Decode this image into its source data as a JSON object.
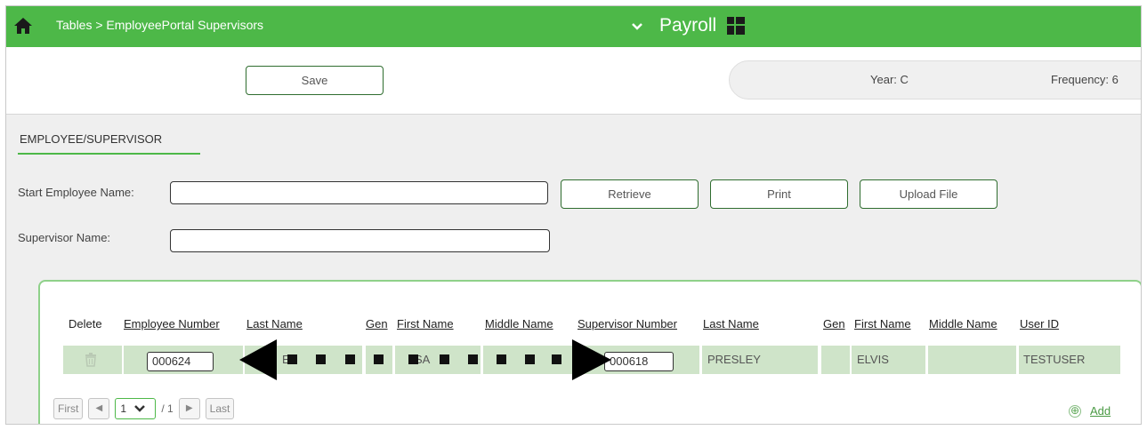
{
  "topbar": {
    "breadcrumb": "Tables > EmployeePortal Supervisors",
    "app_name": "Payroll",
    "app_chevron": "⌄",
    "icons": [
      "home-icon",
      "chevron-down-icon",
      "app-grid-icon"
    ]
  },
  "toolbar": {
    "save_label": "Save",
    "year": "Year: C",
    "frequency": "Frequency: 6"
  },
  "section": {
    "tab_label": "EMPLOYEE/SUPERVISOR"
  },
  "filters": {
    "start_employee_label": "Start Employee Name:",
    "start_employee_value": "",
    "supervisor_label": "Supervisor Name:",
    "supervisor_value": "",
    "retrieve_label": "Retrieve",
    "print_label": "Print",
    "upload_label": "Upload File"
  },
  "grid": {
    "headers": {
      "delete": "Delete",
      "employee_number": "Employee Number",
      "emp_last_name": "Last Name",
      "emp_gen": "Gen",
      "emp_first_name": "First Name",
      "emp_middle_name": "Middle Name",
      "supervisor_number": "Supervisor Number",
      "sup_last_name": "Last Name",
      "sup_gen": "Gen",
      "sup_first_name": "First Name",
      "sup_middle_name": "Middle Name",
      "user_id": "User ID"
    },
    "rows": [
      {
        "employee_number": "000624",
        "emp_last_name": "E",
        "emp_gen": "",
        "emp_first_name": "SA",
        "emp_middle_name": "",
        "supervisor_number": "000618",
        "sup_last_name": "PRESLEY",
        "sup_gen": "",
        "sup_first_name": "ELVIS",
        "sup_middle_name": "",
        "user_id": "TESTUSER"
      }
    ],
    "annotation": "double-headed dashed arrow between employee number and supervisor number"
  },
  "pager": {
    "first": "First",
    "prev": "◀",
    "page": "1",
    "page_chevron": "❯",
    "total": "/ 1",
    "next": "▶",
    "last": "Last"
  },
  "add": {
    "icon": "⊕",
    "label": "Add"
  },
  "colors": {
    "brand_green": "#4db848",
    "row_green": "#cfe4c9",
    "panel_border": "#8fd18a"
  }
}
